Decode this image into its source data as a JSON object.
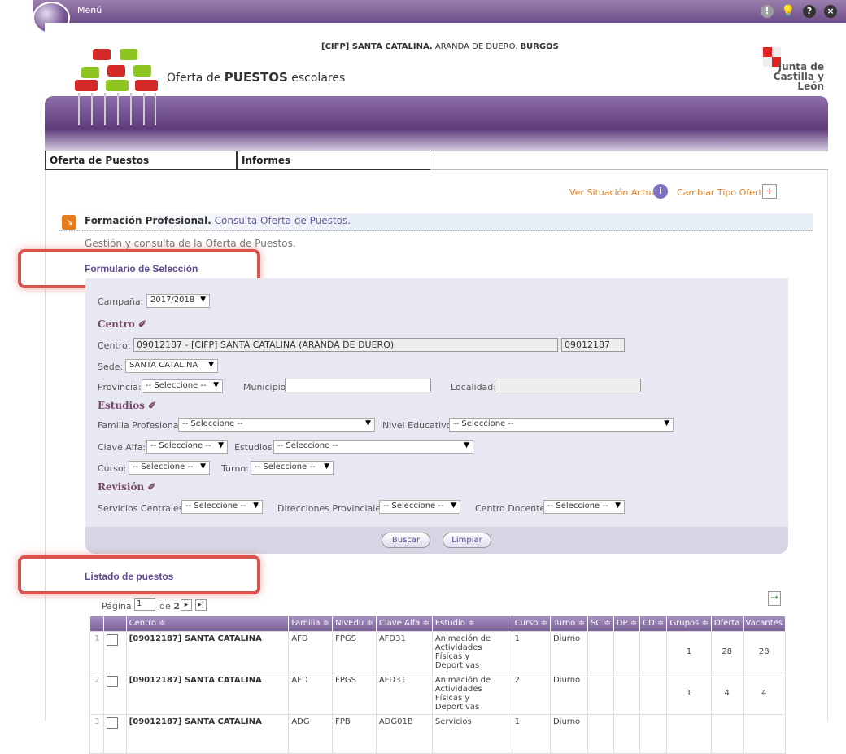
{
  "topbar": {
    "menu_label": "Menú"
  },
  "header": {
    "school_code_name": "[CIFP] SANTA CATALINA.",
    "school_place": " ARANDA DE DUERO. ",
    "school_province": "BURGOS",
    "app_title_prefix": "Oferta de ",
    "app_title_bold": "PUESTOS",
    "app_title_suffix": " escolares",
    "brand_line1": "Junta de",
    "brand_line2": "Castilla y León"
  },
  "nav": {
    "tab1": "Oferta de Puestos",
    "tab2": "Informes"
  },
  "links": {
    "ver_situacion": "Ver Situación Actual",
    "cambiar_tipo": "Cambiar Tipo Oferta"
  },
  "section": {
    "title_bold": "Formación Profesional.",
    "title_rest": " Consulta Oferta de Puestos.",
    "description": "Gestión y consulta de la Oferta de Puestos."
  },
  "form": {
    "heading": "Formulario de Selección",
    "campana_label": "Campaña:",
    "campana_value": "2017/2018",
    "centro_heading": "Centro",
    "centro_label": "Centro:",
    "centro_value": "09012187 - [CIFP] SANTA CATALINA (ARANDA DE DUERO)",
    "centro_code": "09012187",
    "sede_label": "Sede:",
    "sede_value": "SANTA CATALINA",
    "provincia_label": "Provincia:",
    "provincia_value": "-- Seleccione --",
    "municipio_label": "Municipio:",
    "localidad_label": "Localidad:",
    "estudios_heading": "Estudios",
    "familia_label": "Familia Profesional:",
    "familia_value": "-- Seleccione --",
    "nivel_label": "Nivel Educativo:",
    "nivel_value": "-- Seleccione --",
    "clave_label": "Clave Alfa:",
    "clave_value": "-- Seleccione --",
    "estudios_label": "Estudios:",
    "estudios_value": "-- Seleccione --",
    "curso_label": "Curso:",
    "curso_value": "-- Seleccione --",
    "turno_label": "Turno:",
    "turno_value": "-- Seleccione --",
    "revision_heading": "Revisión",
    "servicios_label": "Servicios Centrales:",
    "servicios_value": "-- Seleccione --",
    "direcciones_label": "Direcciones Provinciales:",
    "direcciones_value": "-- Seleccione --",
    "centro_docente_label": "Centro Docente:",
    "centro_docente_value": "-- Seleccione --",
    "buscar": "Buscar",
    "limpiar": "Limpiar"
  },
  "listado": {
    "heading": "Listado de puestos",
    "pagina_label": "Página",
    "pagina_value": "1",
    "de_label": "de",
    "total_pages": "2",
    "columns": [
      "Centro",
      "Familia",
      "NivEdu",
      "Clave Alfa",
      "Estudio",
      "Curso",
      "Turno",
      "SC",
      "DP",
      "CD",
      "Grupos",
      "Oferta",
      "Vacantes"
    ],
    "sort_glyph": "≑",
    "rows": [
      {
        "n": "1",
        "centro": "[09012187] SANTA CATALINA",
        "familia": "AFD",
        "nivedu": "FPGS",
        "clave": "AFD31",
        "estudio": "Animación de Actividades Físicas y Deportivas",
        "curso": "1",
        "turno": "Diurno",
        "sc": "",
        "dp": "",
        "cd": "",
        "grupos": "1",
        "oferta": "28",
        "vacantes": "28"
      },
      {
        "n": "2",
        "centro": "[09012187] SANTA CATALINA",
        "familia": "AFD",
        "nivedu": "FPGS",
        "clave": "AFD31",
        "estudio": "Animación de Actividades Físicas y Deportivas",
        "curso": "2",
        "turno": "Diurno",
        "sc": "",
        "dp": "",
        "cd": "",
        "grupos": "1",
        "oferta": "4",
        "vacantes": "4"
      },
      {
        "n": "3",
        "centro": "[09012187] SANTA CATALINA",
        "familia": "ADG",
        "nivedu": "FPB",
        "clave": "ADG01B",
        "estudio": "Servicios",
        "curso": "1",
        "turno": "Diurno",
        "sc": "",
        "dp": "",
        "cd": "",
        "grupos": "",
        "oferta": "",
        "vacantes": ""
      }
    ]
  }
}
